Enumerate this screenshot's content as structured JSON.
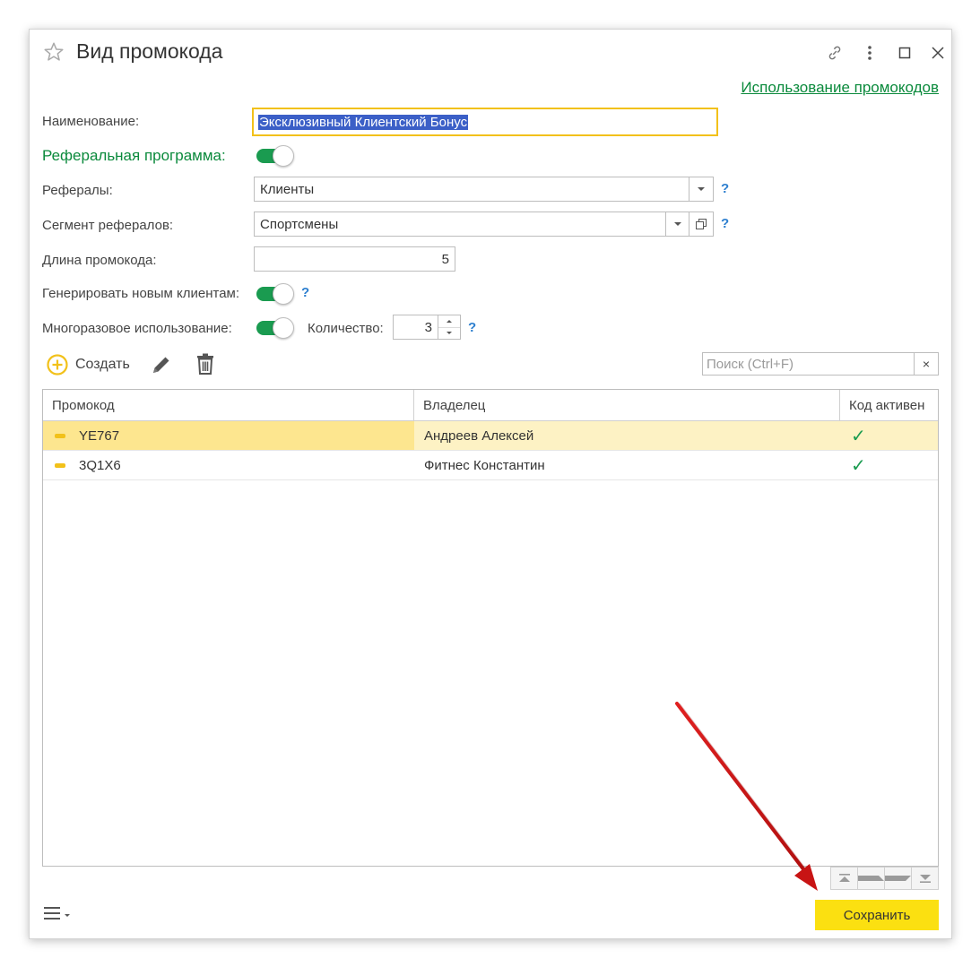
{
  "window": {
    "title": "Вид промокода",
    "top_link": "Использование промокодов"
  },
  "form": {
    "name_label": "Наименование:",
    "name_value": "Эксклюзивный Клиентский Бонус",
    "referral_label": "Реферальная программа:",
    "referral_on": true,
    "referrals_label": "Рефералы:",
    "referrals_value": "Клиенты",
    "segment_label": "Сегмент рефералов:",
    "segment_value": "Спортсмены",
    "length_label": "Длина промокода:",
    "length_value": "5",
    "generate_label": "Генерировать новым клиентам:",
    "generate_on": true,
    "multi_label": "Многоразовое использование:",
    "multi_on": true,
    "count_label": "Количество:",
    "count_value": "3",
    "help": "?"
  },
  "toolbar": {
    "create_label": "Создать",
    "search_placeholder": "Поиск (Ctrl+F)",
    "search_clear": "×"
  },
  "table": {
    "columns": [
      "Промокод",
      "Владелец",
      "Код активен"
    ],
    "rows": [
      {
        "code": "YE767",
        "owner": "Андреев Алексей",
        "active": "✓",
        "selected": true
      },
      {
        "code": "3Q1X6",
        "owner": "Фитнес Константин",
        "active": "✓",
        "selected": false
      }
    ]
  },
  "footer": {
    "save_label": "Сохранить"
  },
  "colors": {
    "accent_green": "#0b8a3c",
    "toggle_green": "#1a9b50",
    "focus_yellow": "#f2c11a",
    "save_yellow": "#fbe011",
    "row_selected": "#fde68f",
    "row_selected_light": "#fdf2c4",
    "annotation_arrow": "#d11a1a"
  },
  "icons": [
    "star-icon",
    "link-icon",
    "more-vertical-icon",
    "maximize-icon",
    "close-icon",
    "plus-circle-icon",
    "pencil-icon",
    "trash-icon",
    "hamburger-menu-icon",
    "copy-icon"
  ]
}
